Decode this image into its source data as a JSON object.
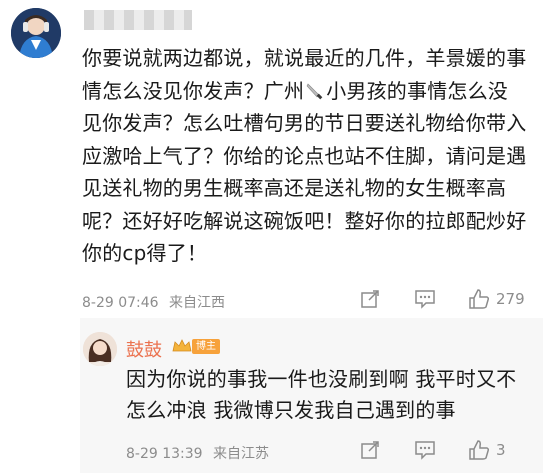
{
  "comment": {
    "text_before_emoji": "你要说就两边都说，就说最近的几件，羊景媛的事情怎么没见你发声？广州",
    "emoji": "knife-icon",
    "text_after_emoji": "小男孩的事情怎么没见你发声？怎么吐槽句男的节日要送礼物给你带入应激哈上气了？你给的论点也站不住脚，请问是遇见送礼物的男生概率高还是送礼物的女生概率高呢？还好好吃解说这碗饭吧！整好你的拉郎配炒好你的cp得了！",
    "date": "8-29 07:46",
    "source": "来自江西",
    "like_count": "279"
  },
  "reply": {
    "username": "鼓鼓",
    "badge": "博主",
    "text": "因为你说的事我一件也没刷到啊 我平时又不怎么冲浪 我微博只发我自己遇到的事",
    "date": "8-29 13:39",
    "source": "来自江苏",
    "like_count": "3"
  },
  "colors": {
    "accent": "#eb7350",
    "meta": "#8c8c8c",
    "badge": "#f7a23b"
  }
}
